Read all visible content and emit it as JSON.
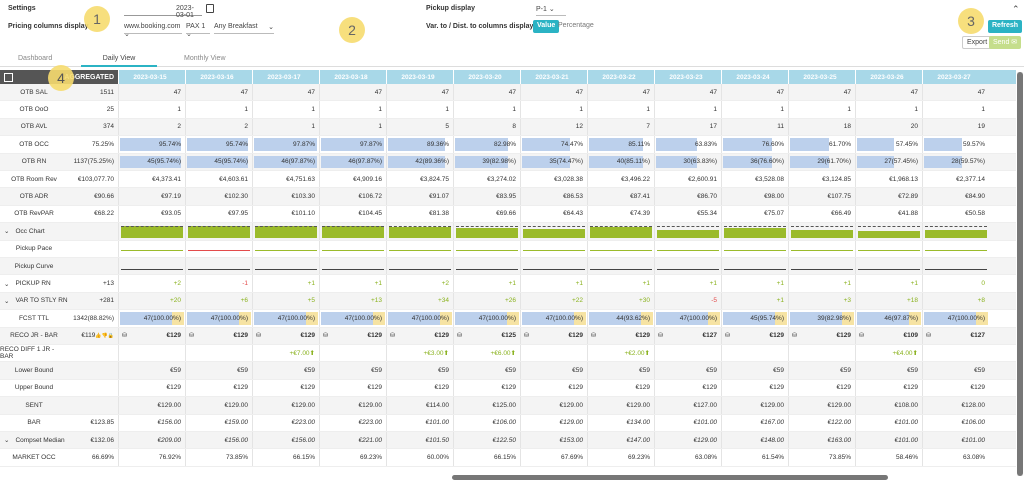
{
  "header": {
    "settings": "Settings",
    "pricing_columns_display": "Pricing columns display",
    "date_value": "2023-03-01",
    "source": "www.booking.com",
    "pax": "PAX 1",
    "breakfast": "Any Breakfast",
    "pickup_display": "Pickup display",
    "pickup_value": "P-1",
    "var_label": "Var. to / Dist. to columns display",
    "value_btn": "Value",
    "percentage_btn": "Percentage",
    "refresh": "Refresh",
    "export": "Export",
    "send": "Send"
  },
  "bubbles": [
    "1",
    "2",
    "3",
    "4"
  ],
  "tabs": [
    "Dashboard",
    "Daily View",
    "Monthly View"
  ],
  "aggregated": "AGGREGATED",
  "dates": [
    "2023-03-15",
    "2023-03-16",
    "2023-03-17",
    "2023-03-18",
    "2023-03-19",
    "2023-03-20",
    "2023-03-21",
    "2023-03-22",
    "2023-03-23",
    "2023-03-24",
    "2023-03-25",
    "2023-03-26",
    "2023-03-27"
  ],
  "rows": [
    {
      "label": "OTB SAL",
      "agg": "1511",
      "cells": [
        "47",
        "47",
        "47",
        "47",
        "47",
        "47",
        "47",
        "47",
        "47",
        "47",
        "47",
        "47",
        "47"
      ]
    },
    {
      "label": "OTB OoO",
      "agg": "25",
      "cells": [
        "1",
        "1",
        "1",
        "1",
        "1",
        "1",
        "1",
        "1",
        "1",
        "1",
        "1",
        "1",
        "1"
      ]
    },
    {
      "label": "OTB AVL",
      "agg": "374",
      "cells": [
        "2",
        "2",
        "1",
        "1",
        "5",
        "8",
        "12",
        "7",
        "17",
        "11",
        "18",
        "20",
        "19"
      ]
    },
    {
      "label": "OTB OCC",
      "agg": "75.25%",
      "type": "occ",
      "cells": [
        "95.74%",
        "95.74%",
        "97.87%",
        "97.87%",
        "89.36%",
        "82.98%",
        "74.47%",
        "85.11%",
        "63.83%",
        "76.60%",
        "61.70%",
        "57.45%",
        "59.57%"
      ],
      "pct": [
        95.74,
        95.74,
        97.87,
        97.87,
        89.36,
        82.98,
        74.47,
        85.11,
        63.83,
        76.6,
        61.7,
        57.45,
        59.57
      ]
    },
    {
      "label": "OTB RN",
      "agg": "1137(75.25%)",
      "type": "occ",
      "cells": [
        "45(95.74%)",
        "45(95.74%)",
        "46(97.87%)",
        "46(97.87%)",
        "42(89.36%)",
        "39(82.98%)",
        "35(74.47%)",
        "40(85.11%)",
        "30(63.83%)",
        "36(76.60%)",
        "29(61.70%)",
        "27(57.45%)",
        "28(59.57%)"
      ],
      "pct": [
        95.74,
        95.74,
        97.87,
        97.87,
        89.36,
        82.98,
        74.47,
        85.11,
        63.83,
        76.6,
        61.7,
        57.45,
        59.57
      ]
    },
    {
      "label": "OTB Room Rev",
      "agg": "€103,077.70",
      "cells": [
        "€4,373.41",
        "€4,603.61",
        "€4,751.63",
        "€4,909.16",
        "€3,824.75",
        "€3,274.02",
        "€3,028.38",
        "€3,496.22",
        "€2,600.91",
        "€3,528.08",
        "€3,124.85",
        "€1,968.13",
        "€2,377.14"
      ]
    },
    {
      "label": "OTB ADR",
      "agg": "€90.66",
      "cells": [
        "€97.19",
        "€102.30",
        "€103.30",
        "€106.72",
        "€91.07",
        "€83.95",
        "€86.53",
        "€87.41",
        "€86.70",
        "€98.00",
        "€107.75",
        "€72.89",
        "€84.90"
      ]
    },
    {
      "label": "OTB RevPAR",
      "agg": "€68.22",
      "cells": [
        "€93.05",
        "€97.95",
        "€101.10",
        "€104.45",
        "€81.38",
        "€69.66",
        "€64.43",
        "€74.39",
        "€55.34",
        "€75.07",
        "€66.49",
        "€41.88",
        "€50.58"
      ]
    },
    {
      "label": "Occ Chart",
      "type": "chart",
      "chart": "occ",
      "arrow": true
    },
    {
      "label": "Pickup Pace",
      "type": "chart",
      "chart": "pace"
    },
    {
      "label": "Pickup Curve",
      "type": "chart",
      "chart": "curve"
    },
    {
      "label": "PICKUP RN",
      "agg": "+13",
      "arrow": true,
      "type": "color",
      "cells": [
        "+2",
        "-1",
        "+1",
        "+1",
        "+2",
        "+1",
        "+1",
        "+1",
        "+1",
        "+1",
        "+1",
        "+1",
        "0"
      ]
    },
    {
      "label": "VAR TO STLY RN",
      "agg": "+281",
      "arrow": true,
      "type": "color",
      "cells": [
        "+20",
        "+6",
        "+5",
        "+13",
        "+34",
        "+26",
        "+22",
        "+30",
        "-5",
        "+1",
        "+3",
        "+18",
        "+8"
      ]
    },
    {
      "label": "FCST TTL",
      "agg": "1342(88.82%)",
      "type": "fcst",
      "cells": [
        "47(100.00%)",
        "47(100.00%)",
        "47(100.00%)",
        "47(100.00%)",
        "47(100.00%)",
        "47(100.00%)",
        "47(100.00%)",
        "44(93.62%)",
        "47(100.00%)",
        "45(95.74%)",
        "39(82.98%)",
        "46(97.87%)",
        "47(100.00%)"
      ],
      "pct": [
        100,
        100,
        100,
        100,
        100,
        100,
        100,
        93.62,
        100,
        95.74,
        82.98,
        97.87,
        100
      ]
    },
    {
      "label": "RECO JR - BAR",
      "agg": "€119",
      "type": "bold",
      "cells": [
        "€129",
        "€129",
        "€129",
        "€129",
        "€129",
        "€125",
        "€129",
        "€129",
        "€127",
        "€129",
        "€129",
        "€109",
        "€127"
      ]
    },
    {
      "label": "RECO DIFF 1 JR - BAR",
      "type": "diff",
      "cells": [
        "",
        "",
        "+€7.00",
        "",
        "+€3.00",
        "+€6.00",
        "",
        "+€2.00",
        "",
        "",
        "",
        "+€4.00",
        ""
      ]
    },
    {
      "label": "Lower Bound",
      "cells": [
        "€59",
        "€59",
        "€59",
        "€59",
        "€59",
        "€59",
        "€59",
        "€59",
        "€59",
        "€59",
        "€59",
        "€59",
        "€59"
      ]
    },
    {
      "label": "Upper Bound",
      "cells": [
        "€129",
        "€129",
        "€129",
        "€129",
        "€129",
        "€129",
        "€129",
        "€129",
        "€129",
        "€129",
        "€129",
        "€129",
        "€129"
      ]
    },
    {
      "label": "SENT",
      "cells": [
        "€129.00",
        "€129.00",
        "€129.00",
        "€129.00",
        "€114.00",
        "€125.00",
        "€129.00",
        "€129.00",
        "€127.00",
        "€129.00",
        "€129.00",
        "€108.00",
        "€128.00"
      ]
    },
    {
      "label": "BAR",
      "agg": "€123.85",
      "type": "italic",
      "cells": [
        "€156.00",
        "€159.00",
        "€223.00",
        "€223.00",
        "€101.00",
        "€106.00",
        "€129.00",
        "€134.00",
        "€101.00",
        "€167.00",
        "€122.00",
        "€101.00",
        "€106.00"
      ]
    },
    {
      "label": "Compset Median",
      "agg": "€132.06",
      "arrow": true,
      "type": "italic",
      "cells": [
        "€209.00",
        "€156.00",
        "€156.00",
        "€221.00",
        "€101.50",
        "€122.50",
        "€153.00",
        "€147.00",
        "€129.00",
        "€148.00",
        "€163.00",
        "€101.00",
        "€101.00"
      ]
    },
    {
      "label": "MARKET OCC",
      "agg": "66.69%",
      "cells": [
        "76.92%",
        "73.85%",
        "66.15%",
        "69.23%",
        "60.00%",
        "66.15%",
        "67.69%",
        "69.23%",
        "63.08%",
        "61.54%",
        "73.85%",
        "58.46%",
        "63.08%"
      ]
    }
  ]
}
